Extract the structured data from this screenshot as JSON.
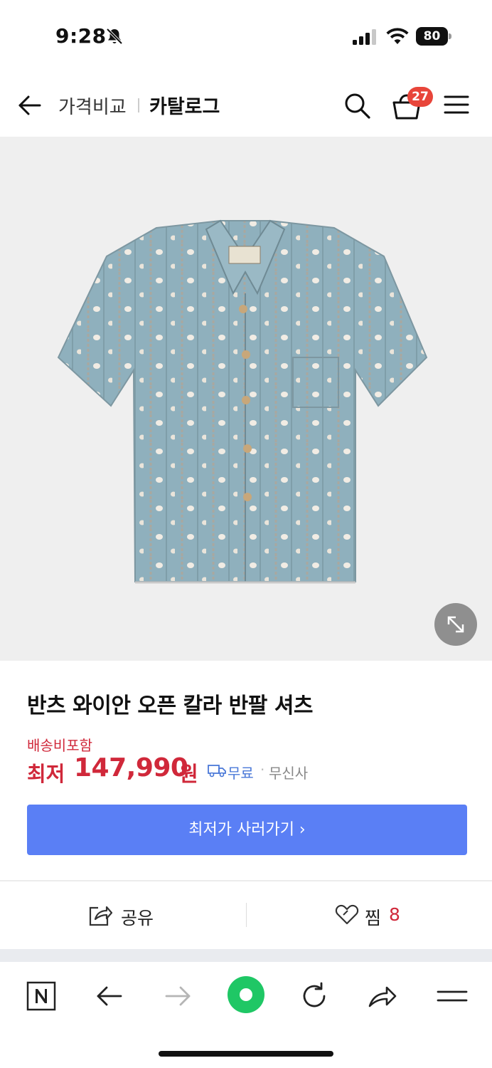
{
  "status_bar": {
    "time": "9:28",
    "battery": "80",
    "icons": [
      "bell-slash-icon",
      "signal-icon",
      "wifi-icon",
      "battery-icon"
    ]
  },
  "header": {
    "breadcrumb_compare": "가격비교",
    "breadcrumb_catalog": "카탈로그",
    "cart_count": "27",
    "icons": [
      "back-arrow-icon",
      "search-icon",
      "cart-icon",
      "menu-icon"
    ]
  },
  "product": {
    "image_icon": "shirt-image",
    "title": "반츠 와이안 오픈 칼라 반팔 셔츠",
    "shipping_included": "배송비포함",
    "price_prefix": "최저",
    "price_value": "147,990",
    "price_unit": "원",
    "shipping_free": "무료",
    "separator": "·",
    "seller": "무신사",
    "buy_button": "최저가 사러가기 ›"
  },
  "actions": {
    "share_label": "공유",
    "like_label": "찜",
    "like_count": "8"
  },
  "browser_toolbar": {
    "items": [
      "naver-icon",
      "back-icon",
      "forward-icon",
      "home-icon",
      "reload-icon",
      "share-icon",
      "more-icon"
    ]
  },
  "colors": {
    "price_red": "#d0283a",
    "button_blue": "#5a7ff5",
    "badge_red": "#e8453a",
    "home_green": "#1fc765",
    "image_bg": "#efefef"
  }
}
